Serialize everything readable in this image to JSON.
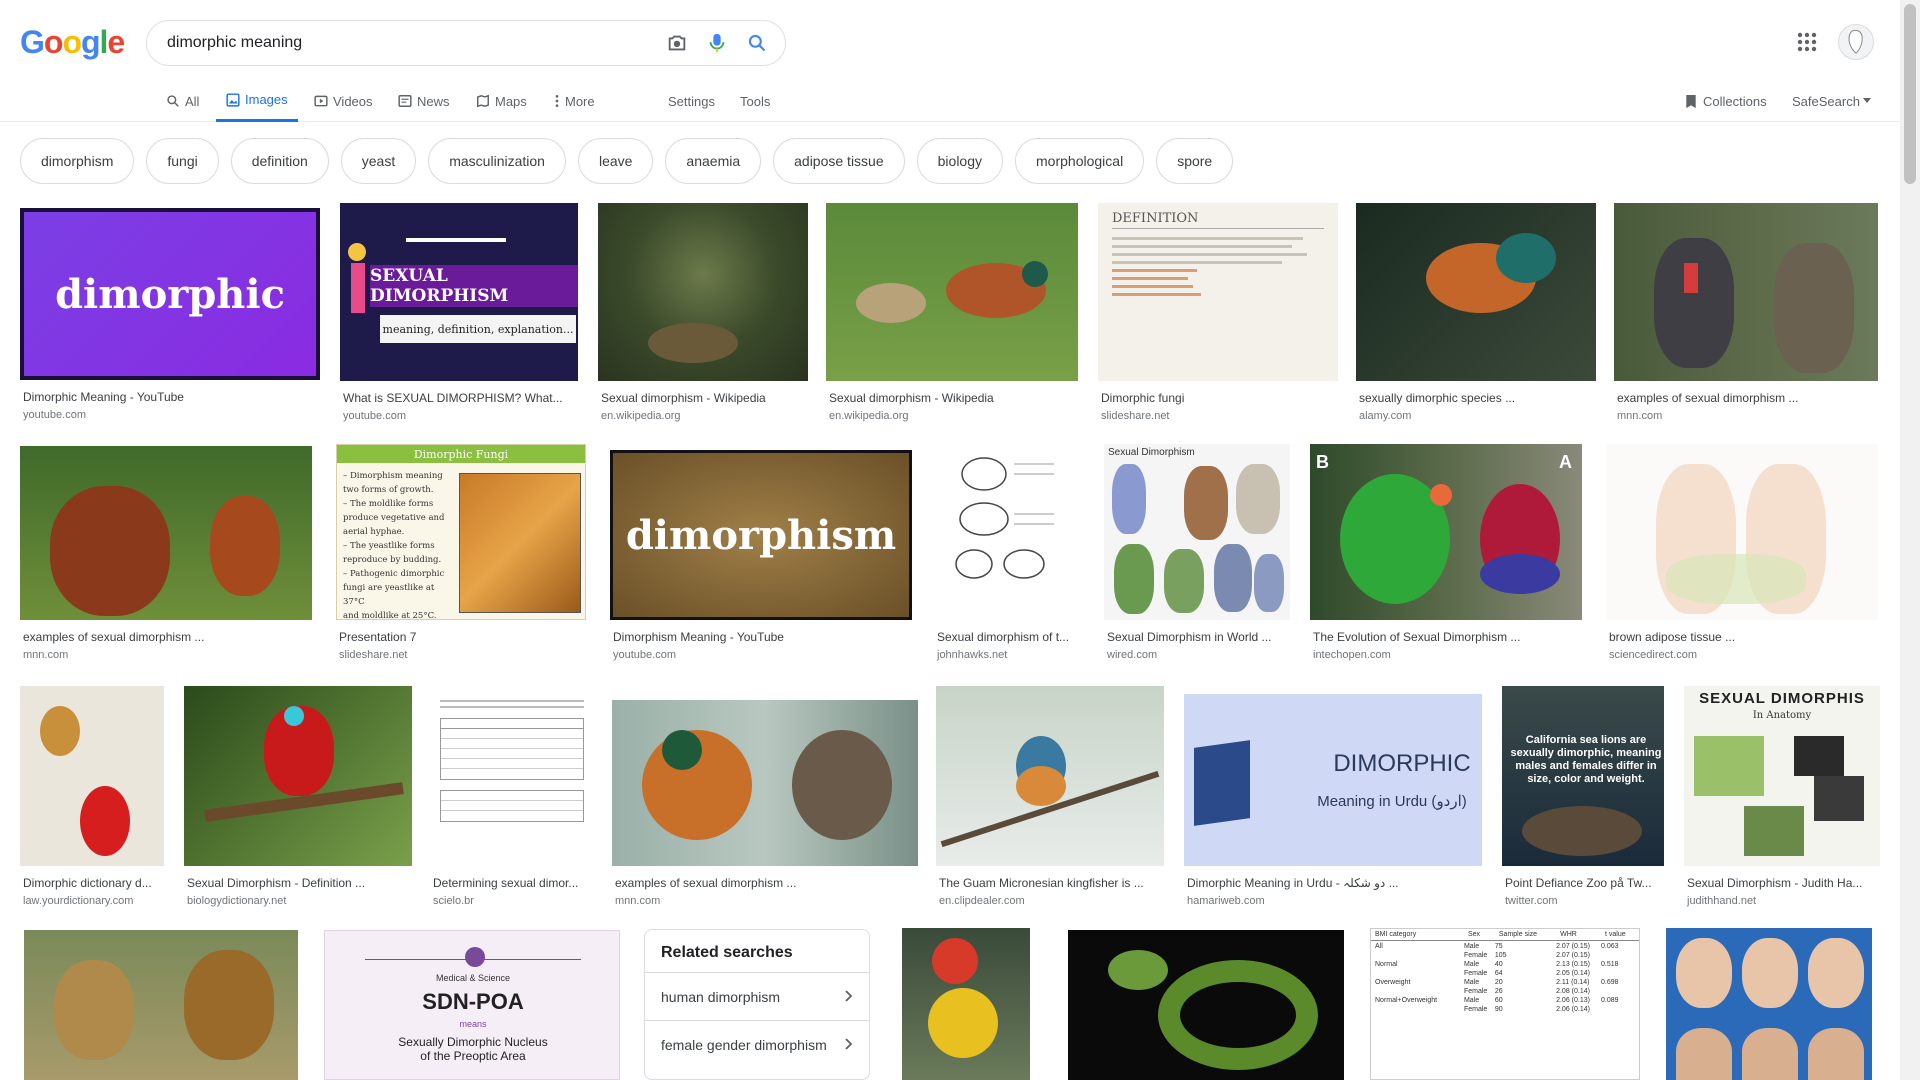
{
  "logo": {
    "letters": [
      "G",
      "o",
      "o",
      "g",
      "l",
      "e"
    ],
    "colors": [
      "#4285f4",
      "#ea4335",
      "#fbbc05",
      "#4285f4",
      "#34a853",
      "#ea4335"
    ]
  },
  "search": {
    "query": "dimorphic meaning"
  },
  "tabs": [
    {
      "label": "All",
      "icon": "search-icon"
    },
    {
      "label": "Images",
      "icon": "image-icon"
    },
    {
      "label": "Videos",
      "icon": "video-icon"
    },
    {
      "label": "News",
      "icon": "news-icon"
    },
    {
      "label": "Maps",
      "icon": "map-icon"
    },
    {
      "label": "More",
      "icon": "more-vert-icon"
    },
    {
      "label": "Settings"
    },
    {
      "label": "Tools"
    }
  ],
  "right_nav": {
    "collections": "Collections",
    "safesearch": "SafeSearch"
  },
  "chips": [
    "dimorphism",
    "fungi",
    "definition",
    "yeast",
    "masculinization",
    "leave",
    "anaemia",
    "adipose tissue",
    "biology",
    "morphological",
    "spore"
  ],
  "results": [
    {
      "caption": "Dimorphic Meaning - YouTube",
      "source": "youtube.com",
      "text": "dimorphic"
    },
    {
      "caption": "What is SEXUAL DIMORPHISM? What...",
      "source": "youtube.com",
      "text": "SEXUAL DIMORPHISM",
      "text2": "meaning, definition, explanation..."
    },
    {
      "caption": "Sexual dimorphism - Wikipedia",
      "source": "en.wikipedia.org"
    },
    {
      "caption": "Sexual dimorphism - Wikipedia",
      "source": "en.wikipedia.org"
    },
    {
      "caption": "Dimorphic fungi",
      "source": "slideshare.net",
      "text": "DEFINITION"
    },
    {
      "caption": "sexually dimorphic species ...",
      "source": "alamy.com"
    },
    {
      "caption": "examples of sexual dimorphism ...",
      "source": "mnn.com"
    },
    {
      "caption": "examples of sexual dimorphism ...",
      "source": "mnn.com"
    },
    {
      "caption": "Presentation 7",
      "source": "slideshare.net",
      "text": "Dimorphic Fungi",
      "lines": [
        "– Dimorphism meaning",
        "two forms of growth.",
        "– The moldlike forms",
        "produce vegetative and",
        "aerial hyphae.",
        "– The yeastlike forms",
        "reproduce by budding.",
        "– Pathogenic dimorphic",
        "fungi are yeastlike at 37°C",
        "and moldlike at 25°C."
      ]
    },
    {
      "caption": "Dimorphism Meaning - YouTube",
      "source": "youtube.com",
      "text": "dimorphism"
    },
    {
      "caption": "Sexual dimorphism of t...",
      "source": "johnhawks.net"
    },
    {
      "caption": "Sexual Dimorphism in World ...",
      "source": "wired.com",
      "text": "Sexual Dimorphism"
    },
    {
      "caption": "The Evolution of Sexual Dimorphism ...",
      "source": "intechopen.com",
      "text": "B",
      "text2": "A"
    },
    {
      "caption": "brown adipose tissue ...",
      "source": "sciencedirect.com"
    },
    {
      "caption": "Dimorphic dictionary d...",
      "source": "law.yourdictionary.com"
    },
    {
      "caption": "Sexual Dimorphism - Definition ...",
      "source": "biologydictionary.net"
    },
    {
      "caption": "Determining sexual dimor...",
      "source": "scielo.br"
    },
    {
      "caption": "examples of sexual dimorphism ...",
      "source": "mnn.com"
    },
    {
      "caption": "The Guam Micronesian kingfisher is ...",
      "source": "en.clipdealer.com"
    },
    {
      "caption": "Dimorphic Meaning in Urdu - دو شکلہ ...",
      "source": "hamariweb.com",
      "text": "DIMORPHIC",
      "text2": "Meaning in Urdu (اردو)"
    },
    {
      "caption": "Point Defiance Zoo på Tw...",
      "source": "twitter.com",
      "text": "California sea lions are sexually dimorphic, meaning males and females differ in size, color and weight."
    },
    {
      "caption": "Sexual Dimorphism - Judith Ha...",
      "source": "judithhand.net",
      "text": "SEXUAL DIMORPHIS",
      "text2": "In Anatomy"
    },
    {
      "caption": "",
      "source": ""
    },
    {
      "caption": "",
      "source": "",
      "text": "SDN-POA",
      "text2": "Medical & Science",
      "text3": "means",
      "text4": "Sexually Dimorphic Nucleus of the Preoptic Area"
    },
    {
      "caption": "",
      "source": ""
    },
    {
      "caption": "",
      "source": ""
    },
    {
      "caption": "",
      "source": "",
      "table_header": [
        "BMI category",
        "Sex",
        "Sample size",
        "WHR",
        "t value"
      ],
      "table_rows": [
        [
          "All",
          "Male",
          "75",
          "2.07 (0.15)",
          "0.063"
        ],
        [
          "",
          "Female",
          "105",
          "2.07 (0.15)",
          ""
        ],
        [
          "Normal",
          "Male",
          "40",
          "2.13 (0.15)",
          "0.518"
        ],
        [
          "",
          "Female",
          "64",
          "2.05 (0.14)",
          ""
        ],
        [
          "Overweight",
          "Male",
          "20",
          "2.11 (0.14)",
          "0.698"
        ],
        [
          "",
          "Female",
          "26",
          "2.08 (0.14)",
          ""
        ],
        [
          "Normal+Overweight",
          "Male",
          "60",
          "2.06 (0.13)",
          "0.089"
        ],
        [
          "",
          "Female",
          "90",
          "2.06 (0.14)",
          ""
        ]
      ]
    },
    {
      "caption": "",
      "source": ""
    }
  ],
  "related": {
    "title": "Related searches",
    "items": [
      "human dimorphism",
      "female gender dimorphism"
    ]
  }
}
